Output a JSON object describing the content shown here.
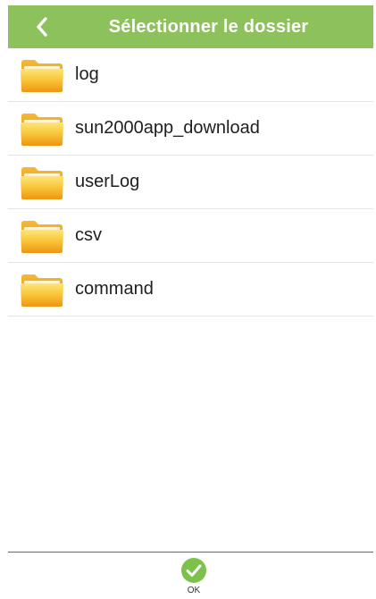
{
  "header": {
    "title": "Sélectionner le dossier",
    "back_icon": "chevron-left-icon",
    "background_color": "#8dc15c"
  },
  "folders": [
    {
      "name": "log",
      "icon": "folder-icon"
    },
    {
      "name": "sun2000app_download",
      "icon": "folder-icon"
    },
    {
      "name": "userLog",
      "icon": "folder-icon"
    },
    {
      "name": "csv",
      "icon": "folder-icon"
    },
    {
      "name": "command",
      "icon": "folder-icon"
    }
  ],
  "footer": {
    "ok_label": "OK",
    "ok_icon": "check-circle-icon",
    "ok_color": "#7cc24a",
    "divider_color": "#3f6ea3"
  }
}
